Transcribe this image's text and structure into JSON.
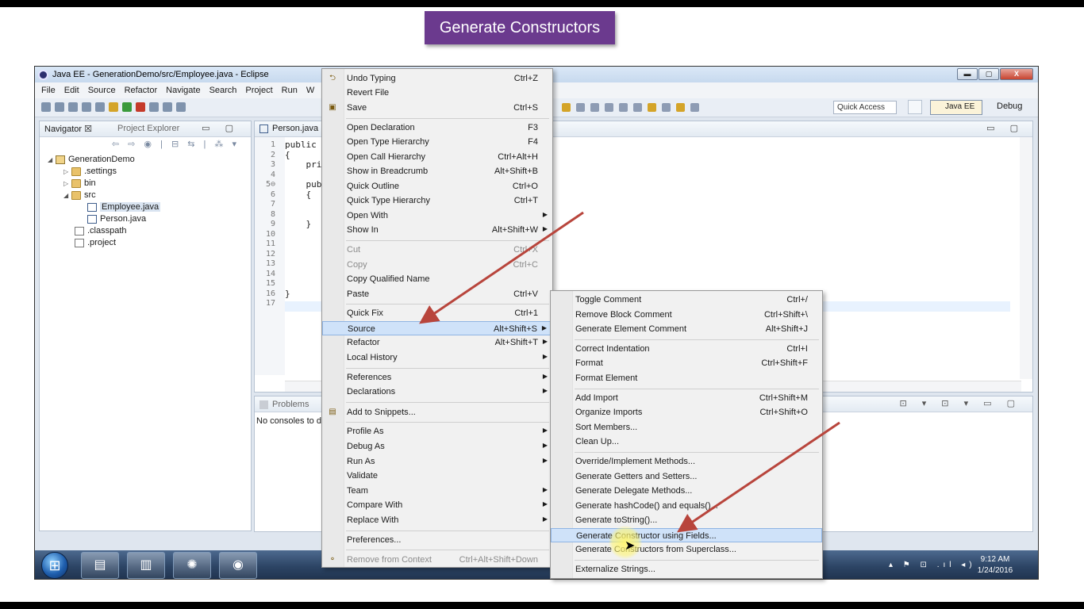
{
  "banner": {
    "text": "Generate Constructors"
  },
  "window": {
    "title": "Java EE - GenerationDemo/src/Employee.java - Eclipse",
    "buttons": {
      "minimize": "▬",
      "maximize": "▢",
      "close": "X"
    }
  },
  "menubar": {
    "items": [
      "File",
      "Edit",
      "Source",
      "Refactor",
      "Navigate",
      "Search",
      "Project",
      "Run",
      "W"
    ]
  },
  "toolbar": {
    "quick_access": "Quick Access",
    "perspective_javaee": "Java EE",
    "perspective_debug": "Debug"
  },
  "navigator": {
    "tab_active": "Navigator ☒",
    "tab_inactive": "Project Explorer",
    "controls": "▭ ▢",
    "tools": "⇦ ⇨ ◉ | ⊟ ⇆ | ⁂ ▾",
    "items": [
      {
        "label": "GenerationDemo",
        "twisty": "◢",
        "icon": "project"
      },
      {
        "label": ".settings",
        "twisty": "▷",
        "icon": "folder"
      },
      {
        "label": "bin",
        "twisty": "▷",
        "icon": "folder"
      },
      {
        "label": "src",
        "twisty": "◢",
        "icon": "folder"
      },
      {
        "label": "Employee.java",
        "twisty": "",
        "icon": "java"
      },
      {
        "label": "Person.java",
        "twisty": "",
        "icon": "java"
      },
      {
        "label": ".classpath",
        "twisty": "",
        "icon": "xml"
      },
      {
        "label": ".project",
        "twisty": "",
        "icon": "xml"
      }
    ]
  },
  "editor": {
    "tab": "Person.java",
    "controls": "▭ ▢",
    "line_numbers": [
      "1",
      "2",
      "3",
      "4",
      "5⊖",
      "6",
      "7",
      "8",
      "9",
      "10",
      "11",
      "12",
      "13",
      "14",
      "15",
      "16",
      "17"
    ],
    "code_lines": [
      "public c",
      "{",
      "    priv",
      "",
      "    publ",
      "    {",
      "",
      "",
      "    }",
      "",
      "",
      "",
      "",
      "",
      "",
      "}",
      ""
    ]
  },
  "console": {
    "tab": "Problems",
    "text": "No consoles to d",
    "controls": "⊡ ▾ ⊡ ▾ ▭ ▢"
  },
  "context_menu": {
    "items": [
      {
        "label": "Undo Typing",
        "acc": "Ctrl+Z",
        "icon": "⮌"
      },
      {
        "label": "Revert File",
        "acc": ""
      },
      {
        "label": "Save",
        "acc": "Ctrl+S",
        "icon": "▣"
      },
      {
        "label": "Open Declaration",
        "acc": "F3"
      },
      {
        "label": "Open Type Hierarchy",
        "acc": "F4"
      },
      {
        "label": "Open Call Hierarchy",
        "acc": "Ctrl+Alt+H"
      },
      {
        "label": "Show in Breadcrumb",
        "acc": "Alt+Shift+B"
      },
      {
        "label": "Quick Outline",
        "acc": "Ctrl+O"
      },
      {
        "label": "Quick Type Hierarchy",
        "acc": "Ctrl+T"
      },
      {
        "label": "Open With",
        "acc": ""
      },
      {
        "label": "Show In",
        "acc": "Alt+Shift+W"
      },
      {
        "label": "Cut",
        "acc": "Ctrl+X"
      },
      {
        "label": "Copy",
        "acc": "Ctrl+C"
      },
      {
        "label": "Copy Qualified Name",
        "acc": ""
      },
      {
        "label": "Paste",
        "acc": "Ctrl+V"
      },
      {
        "label": "Quick Fix",
        "acc": "Ctrl+1"
      },
      {
        "label": "Source",
        "acc": "Alt+Shift+S"
      },
      {
        "label": "Refactor",
        "acc": "Alt+Shift+T"
      },
      {
        "label": "Local History",
        "acc": ""
      },
      {
        "label": "References",
        "acc": ""
      },
      {
        "label": "Declarations",
        "acc": ""
      },
      {
        "label": "Add to Snippets...",
        "acc": "",
        "icon": "▤"
      },
      {
        "label": "Profile As",
        "acc": ""
      },
      {
        "label": "Debug As",
        "acc": ""
      },
      {
        "label": "Run As",
        "acc": ""
      },
      {
        "label": "Validate",
        "acc": ""
      },
      {
        "label": "Team",
        "acc": ""
      },
      {
        "label": "Compare With",
        "acc": ""
      },
      {
        "label": "Replace With",
        "acc": ""
      },
      {
        "label": "Preferences...",
        "acc": ""
      },
      {
        "label": "Remove from Context",
        "acc": "Ctrl+Alt+Shift+Down",
        "icon": "⚬"
      }
    ]
  },
  "source_menu": {
    "items": [
      {
        "label": "Toggle Comment",
        "acc": "Ctrl+/"
      },
      {
        "label": "Remove Block Comment",
        "acc": "Ctrl+Shift+\\"
      },
      {
        "label": "Generate Element Comment",
        "acc": "Alt+Shift+J"
      },
      {
        "label": "Correct Indentation",
        "acc": "Ctrl+I"
      },
      {
        "label": "Format",
        "acc": "Ctrl+Shift+F"
      },
      {
        "label": "Format Element",
        "acc": ""
      },
      {
        "label": "Add Import",
        "acc": "Ctrl+Shift+M"
      },
      {
        "label": "Organize Imports",
        "acc": "Ctrl+Shift+O"
      },
      {
        "label": "Sort Members...",
        "acc": ""
      },
      {
        "label": "Clean Up...",
        "acc": ""
      },
      {
        "label": "Override/Implement Methods...",
        "acc": ""
      },
      {
        "label": "Generate Getters and Setters...",
        "acc": ""
      },
      {
        "label": "Generate Delegate Methods...",
        "acc": ""
      },
      {
        "label": "Generate hashCode() and equals()...",
        "acc": ""
      },
      {
        "label": "Generate toString()...",
        "acc": ""
      },
      {
        "label": "Generate Constructor using Fields...",
        "acc": ""
      },
      {
        "label": "Generate Constructors from Superclass...",
        "acc": ""
      },
      {
        "label": "Externalize Strings...",
        "acc": ""
      }
    ]
  },
  "taskbar": {
    "start": "⊞",
    "apps": [
      "▤",
      "▥",
      "✺",
      "◉"
    ],
    "tray": "▴ ⚑ ⊡ .ıl ◂)",
    "time": "9:12 AM",
    "date": "1/24/2016"
  },
  "colors": {
    "banner": "#6b3a8e",
    "arrow": "#b8453c",
    "highlight": "#cfe2f9"
  }
}
